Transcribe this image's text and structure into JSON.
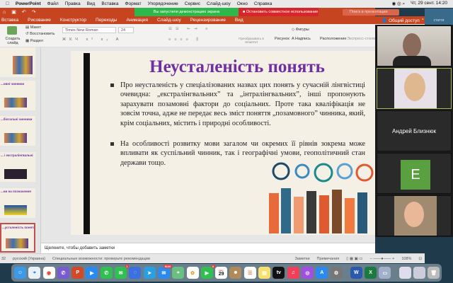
{
  "menubar": {
    "app": "PowerPoint",
    "items": [
      "Файл",
      "Правка",
      "Вид",
      "Вставка",
      "Формат",
      "Упорядочение",
      "Сервис",
      "Слайд-шоу",
      "Окно",
      "Справка"
    ],
    "datetime": "Чт, 29 сент.  14:20"
  },
  "screen_share": {
    "status": "Вы запустили демонстрацию экрана",
    "stop": "Остановить совместное использование"
  },
  "search_placeholder": "Поиск в презентации",
  "tabs": [
    "Вставка",
    "Рисование",
    "Конструктор",
    "Переходы",
    "Анимация",
    "Слайд-шоу",
    "Рецензирование",
    "Вид"
  ],
  "share_label": "Общий доступ",
  "desktop_file": "статти",
  "ribbon": {
    "new_slide": "Создать слайд",
    "layout": "Макет",
    "reset": "Восстановить",
    "section": "Раздел",
    "font": "Times New Roman",
    "size": "24",
    "convert": "Преобразовать в SmartArt",
    "picture": "Рисунок",
    "shapes": "Фигуры",
    "textbox": "Надпись",
    "arrange": "Расположение",
    "styles": "Экспресс-стили"
  },
  "thumbs": [
    "",
    "...овні чинники",
    "...біогальні чинники",
    "... і екстралінгвальні",
    "...ни на позначення",
    "...усталеність понять"
  ],
  "slide": {
    "title": "Неусталеність понять",
    "bullets": [
      "Про неусталеність у спеціалізованих назвах цих понять у сучасній лінгвістиці очевидна: „екстралінгвальних” та „інтралінгвальних”, інші пропонують зарахувати позамовні фактори до соціальних. Проте така кваліфікація не зовсім точна, адже не передає весь зміст поняття „позамовного” чинника, який, крім соціальних, містить і природні особливості.",
      "На особливості розвитку мови загалом чи окремих її рівнів зокрема може впливати як суспільний чинник, так і географічні умови, геополітичний стан держави тощо."
    ]
  },
  "notes_placeholder": "Щелкните, чтобы добавить заметки",
  "status": {
    "slide": "32",
    "language": "русский (Украина)",
    "accessibility": "Специальные возможности: проверьте рекомендации",
    "notes": "Заметки",
    "comments": "Примечания",
    "zoom": "108%"
  },
  "zoom": {
    "participant": "Андрей Близнюк",
    "initial": "E"
  },
  "dock": {
    "mail_badge": "5130",
    "messages_badge": "1",
    "facetime_badge": "6",
    "calendar_month": "сент.",
    "calendar_day": "29"
  }
}
